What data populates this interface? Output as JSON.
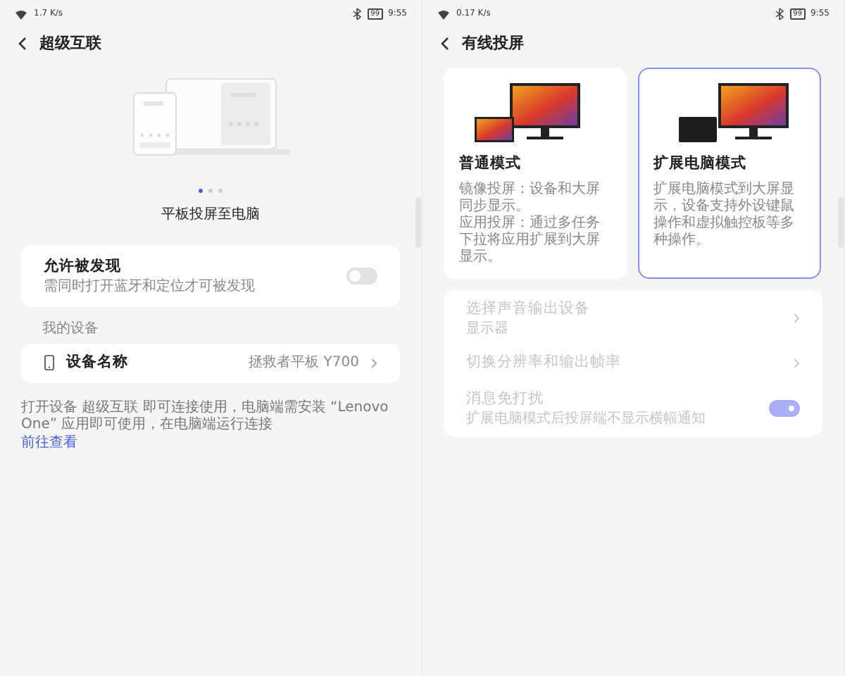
{
  "left_pane": {
    "status_bar": {
      "speed": "1.7 K/s",
      "battery": "99",
      "time": "9:55"
    },
    "title": "超级互联",
    "pager": [
      {
        "selected": true
      },
      {
        "selected": false
      },
      {
        "selected": false
      }
    ],
    "caption": "平板投屏至电脑",
    "discover": {
      "label": "允许被发现",
      "hint": "需同时打开蓝牙和定位才可被发现",
      "on": false
    },
    "section_label": "我的设备",
    "device": {
      "label": "设备名称",
      "value": "拯救者平板 Y700"
    },
    "footer": {
      "text": "打开设备 超级互联 即可连接使用，电脑端需安装 “Lenovo One” 应用即可使用，在电脑端运行连接",
      "link": "前往查看"
    }
  },
  "right_pane": {
    "status_bar": {
      "speed": "0.17 K/s",
      "battery": "99",
      "time": "9:55"
    },
    "title": "有线投屏",
    "modes": [
      {
        "kind": "mirror",
        "title": "普通模式",
        "lines": [
          "镜像投屏：设备和大屏同步显示。",
          "应用投屏：通过多任务下拉将应用扩展到大屏显示。"
        ],
        "selected": false
      },
      {
        "kind": "extend",
        "title": "扩展电脑模式",
        "lines": [
          "扩展电脑模式到大屏显示，设备支持外设键鼠操作和虚拟触控板等多种操作。"
        ],
        "selected": true
      }
    ],
    "settings": [
      {
        "kind": "link",
        "label": "选择声音输出设备",
        "hint": "显示器",
        "disabled": true
      },
      {
        "kind": "link",
        "label": "切换分辨率和输出帧率",
        "disabled": true
      },
      {
        "kind": "switch",
        "label": "消息免打扰",
        "hint": "扩展电脑模式后投屏端不显示横幅通知",
        "disabled": true,
        "on": true
      }
    ]
  }
}
